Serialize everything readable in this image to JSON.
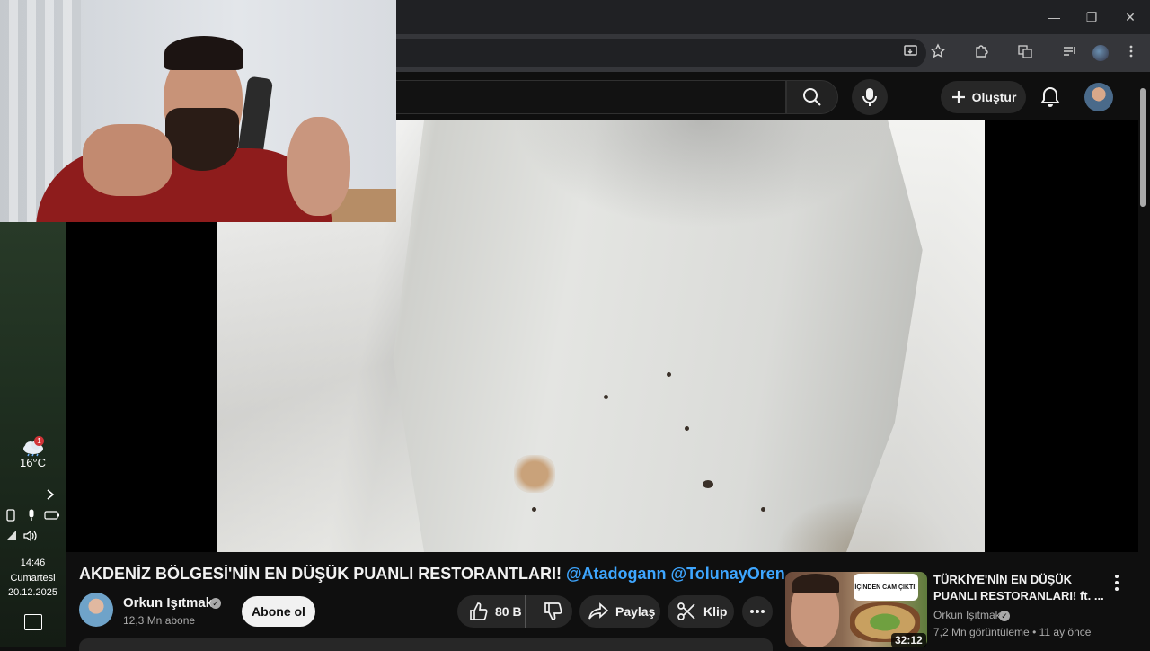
{
  "browser": {
    "window_controls": {
      "minimize": "—",
      "restore": "❐",
      "close": "✕"
    },
    "toolbar_icons": [
      "install-app-icon",
      "bookmark-star-icon",
      "extensions-icon",
      "translate-icon",
      "media-control-icon",
      "profile-icon",
      "menu-icon"
    ]
  },
  "youtube_header": {
    "create_label": "Oluştur"
  },
  "taskbar": {
    "weather_badge": "1",
    "weather_temp": "16°C",
    "clock_time": "14:46",
    "clock_day": "Cumartesi",
    "clock_date": "20.12.2025"
  },
  "video": {
    "title_main": "AKDENİZ BÖLGESİ'NİN EN DÜŞÜK PUANLI RESTORANTLARI!",
    "title_mentions": "@Atadogann @TolunayOren",
    "channel_name": "Orkun Işıtmak",
    "subscriber_count": "12,3 Mn abone",
    "subscribe_label": "Abone ol",
    "like_count": "80 B",
    "share_label": "Paylaş",
    "clip_label": "Klip"
  },
  "recommendation": {
    "thumb_text": "İÇİNDEN CAM ÇIKTI!",
    "duration": "32:12",
    "title": "TÜRKİYE'NİN EN DÜŞÜK PUANLI RESTORANLARI! ft. ...",
    "channel": "Orkun Işıtmak",
    "meta": "7,2 Mn görüntüleme • 11 ay önce"
  },
  "colors": {
    "background": "#0f0f0f",
    "mention_link": "#3ea6ff",
    "pill_bg": "#272727"
  }
}
